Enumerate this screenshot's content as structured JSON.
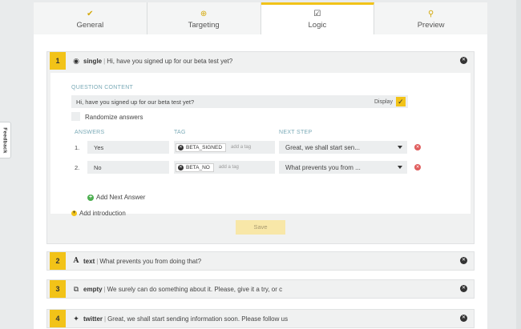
{
  "tabs": [
    {
      "label": "General",
      "icon": "check-icon",
      "glyph": "✔"
    },
    {
      "label": "Targeting",
      "icon": "target-icon",
      "glyph": "⊕"
    },
    {
      "label": "Logic",
      "icon": "checkbox-icon",
      "glyph": "☑"
    },
    {
      "label": "Preview",
      "icon": "magnifier-icon",
      "glyph": "⚲"
    }
  ],
  "feedback_label": "Feedback",
  "question1": {
    "number": "1",
    "type": "single",
    "text": "Hi, have you signed up for our beta test yet?",
    "content_label": "QUESTION CONTENT",
    "content_value": "Hi, have you signed up for our beta test yet?",
    "display_label": "Display",
    "randomize_label": "Randomize answers",
    "answers_label": "ANSWERS",
    "tag_label": "TAG",
    "next_step_label": "NEXT STEP",
    "answers": [
      {
        "num": "1.",
        "value": "Yes",
        "tag": "BETA_SIGNED",
        "tag_placeholder": "add a tag",
        "next": "Great, we shall start sen..."
      },
      {
        "num": "2.",
        "value": "No",
        "tag": "BETA_NO",
        "tag_placeholder": "add a tag",
        "next": "What prevents you from ..."
      }
    ],
    "add_next_answer": "Add Next Answer",
    "add_introduction": "Add introduction"
  },
  "save_label": "Save",
  "questions": [
    {
      "number": "2",
      "type": "text",
      "glyph": "A",
      "text": "What prevents you from doing that?"
    },
    {
      "number": "3",
      "type": "empty",
      "glyph": "⧉",
      "text": "We surely can do something about it. Please, give it a try, or c"
    },
    {
      "number": "4",
      "type": "twitter",
      "glyph": "✦",
      "text": "Great, we shall start sending information soon. Please follow us"
    }
  ],
  "colors": {
    "accent": "#f2c318",
    "delete": "#e05d5d",
    "add": "#4caf50"
  }
}
